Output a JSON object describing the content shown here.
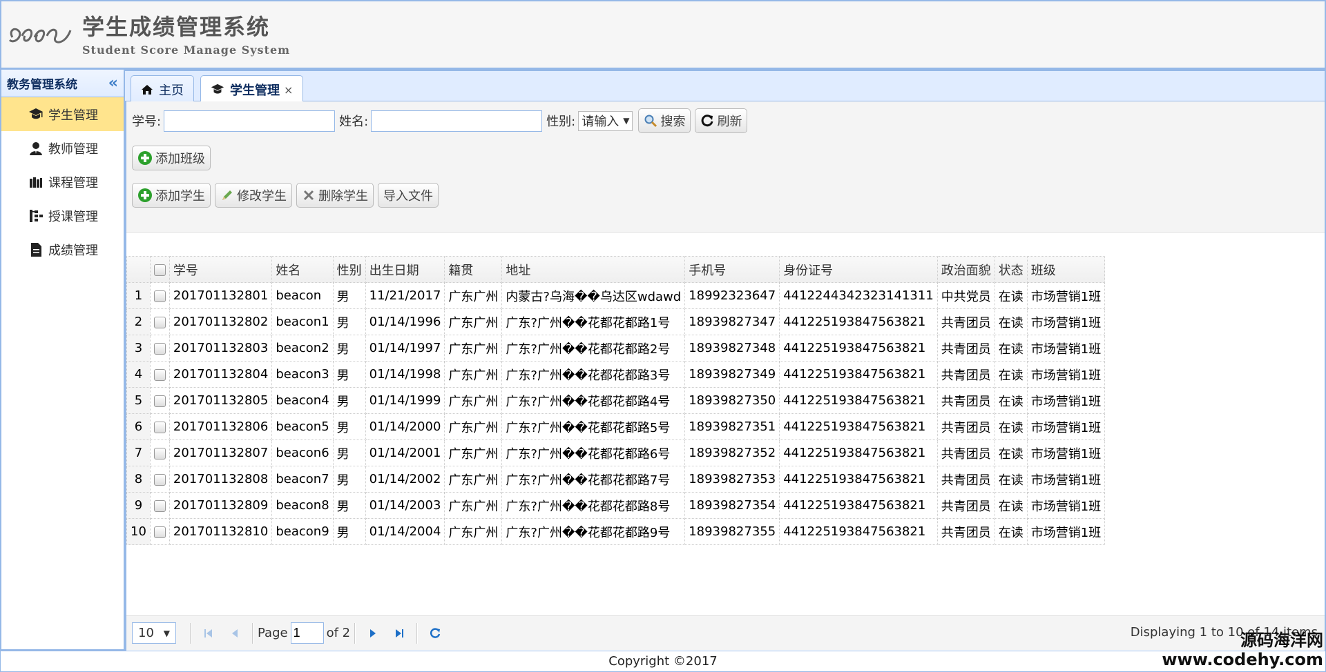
{
  "header": {
    "title": "学生成绩管理系统",
    "subtitle": "Student Score Manage System"
  },
  "sidebar": {
    "title": "教务管理系统",
    "items": [
      {
        "label": "学生管理",
        "icon": "graduation-cap-icon",
        "active": true
      },
      {
        "label": "教师管理",
        "icon": "teacher-icon",
        "active": false
      },
      {
        "label": "课程管理",
        "icon": "books-icon",
        "active": false
      },
      {
        "label": "授课管理",
        "icon": "org-chart-icon",
        "active": false
      },
      {
        "label": "成绩管理",
        "icon": "document-icon",
        "active": false
      }
    ]
  },
  "tabs": [
    {
      "label": "主页",
      "icon": "home-icon"
    },
    {
      "label": "学生管理",
      "icon": "graduation-cap-icon",
      "close": "×"
    }
  ],
  "search": {
    "id_label": "学号:",
    "name_label": "姓名:",
    "gender_label": "性别:",
    "gender_value": "请输入",
    "search_button": "搜索",
    "refresh_button": "刷新"
  },
  "toolbar": {
    "add_class": "添加班级",
    "add_student": "添加学生",
    "edit_student": "修改学生",
    "delete_student": "删除学生",
    "import_file": "导入文件"
  },
  "table": {
    "columns": [
      "学号",
      "姓名",
      "性别",
      "出生日期",
      "籍贯",
      "地址",
      "手机号",
      "身份证号",
      "政治面貌",
      "状态",
      "班级"
    ],
    "rows": [
      [
        "1",
        "201701132801",
        "beacon",
        "男",
        "11/21/2017",
        "广东广州",
        "内蒙古?乌海��乌达区wdawd",
        "18992323647",
        "441224434232314131​1",
        "中共党员",
        "在读",
        "市场营销1班"
      ],
      [
        "2",
        "201701132802",
        "beacon1",
        "男",
        "01/14/1996",
        "广东广州",
        "广东?广州��花都花都路1号",
        "18939827347",
        "441225193847563821",
        "共青团员",
        "在读",
        "市场营销1班"
      ],
      [
        "3",
        "201701132803",
        "beacon2",
        "男",
        "01/14/1997",
        "广东广州",
        "广东?广州��花都花都路2号",
        "18939827348",
        "441225193847563821",
        "共青团员",
        "在读",
        "市场营销1班"
      ],
      [
        "4",
        "201701132804",
        "beacon3",
        "男",
        "01/14/1998",
        "广东广州",
        "广东?广州��花都花都路3号",
        "18939827349",
        "441225193847563821",
        "共青团员",
        "在读",
        "市场营销1班"
      ],
      [
        "5",
        "201701132805",
        "beacon4",
        "男",
        "01/14/1999",
        "广东广州",
        "广东?广州��花都花都路4号",
        "18939827350",
        "441225193847563821",
        "共青团员",
        "在读",
        "市场营销1班"
      ],
      [
        "6",
        "201701132806",
        "beacon5",
        "男",
        "01/14/2000",
        "广东广州",
        "广东?广州��花都花都路5号",
        "18939827351",
        "441225193847563821",
        "共青团员",
        "在读",
        "市场营销1班"
      ],
      [
        "7",
        "201701132807",
        "beacon6",
        "男",
        "01/14/2001",
        "广东广州",
        "广东?广州��花都花都路6号",
        "18939827352",
        "441225193847563821",
        "共青团员",
        "在读",
        "市场营销1班"
      ],
      [
        "8",
        "201701132808",
        "beacon7",
        "男",
        "01/14/2002",
        "广东广州",
        "广东?广州��花都花都路7号",
        "18939827353",
        "441225193847563821",
        "共青团员",
        "在读",
        "市场营销1班"
      ],
      [
        "9",
        "201701132809",
        "beacon8",
        "男",
        "01/14/2003",
        "广东广州",
        "广东?广州��花都花都路8号",
        "18939827354",
        "441225193847563821",
        "共青团员",
        "在读",
        "市场营销1班"
      ],
      [
        "10",
        "201701132810",
        "beacon9",
        "男",
        "01/14/2004",
        "广东广州",
        "广东?广州��花都花都路9号",
        "18939827355",
        "441225193847563821",
        "共青团员",
        "在读",
        "市场营销1班"
      ]
    ]
  },
  "pager": {
    "page_size": "10",
    "page_label": "Page",
    "page_value": "1",
    "of_label": "of 2",
    "info": "Displaying 1 to 10 of 14 items"
  },
  "footer": {
    "copyright": "Copyright ©2017"
  },
  "watermark": {
    "line1": "源码海洋网",
    "line2": "www.codehy.com"
  },
  "colors": {
    "border": "#95b8e7",
    "active_menu": "#ffe48d",
    "tab_bg": "#e0ecff"
  }
}
